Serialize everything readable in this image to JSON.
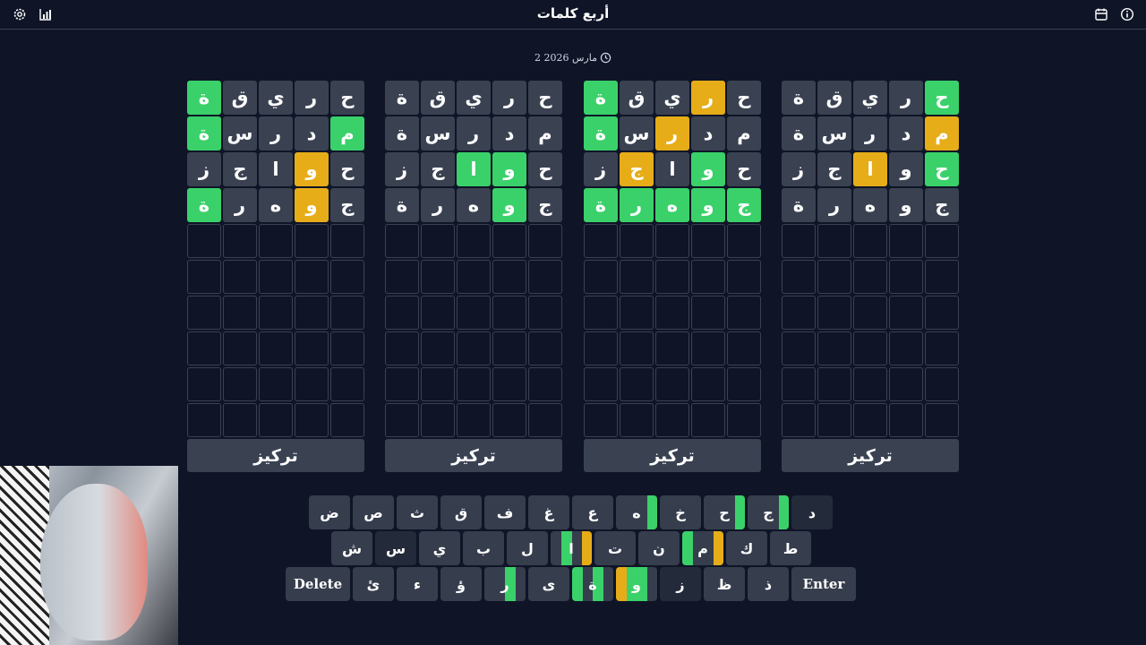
{
  "header": {
    "title": "أربع كلمات"
  },
  "icons": {
    "left": [
      "gear-icon",
      "chart-icon"
    ],
    "right": [
      "calendar-icon",
      "info-icon"
    ]
  },
  "date": "2 مارس 2026",
  "colors": {
    "green": "#3ad16a",
    "yellow": "#e6ad18",
    "tile": "#3a4252",
    "background": "#0f1527"
  },
  "boards": [
    {
      "focus_label": "تركيز",
      "rows": [
        [
          [
            "ح",
            ""
          ],
          [
            "ر",
            ""
          ],
          [
            "ي",
            ""
          ],
          [
            "ق",
            ""
          ],
          [
            "ة",
            "g"
          ]
        ],
        [
          [
            "م",
            "g"
          ],
          [
            "د",
            ""
          ],
          [
            "ر",
            ""
          ],
          [
            "س",
            ""
          ],
          [
            "ة",
            "g"
          ]
        ],
        [
          [
            "ح",
            ""
          ],
          [
            "و",
            "y"
          ],
          [
            "ا",
            ""
          ],
          [
            "ج",
            ""
          ],
          [
            "ز",
            ""
          ]
        ],
        [
          [
            "ج",
            ""
          ],
          [
            "و",
            "y"
          ],
          [
            "ه",
            ""
          ],
          [
            "ر",
            ""
          ],
          [
            "ة",
            "g"
          ]
        ]
      ]
    },
    {
      "focus_label": "تركيز",
      "rows": [
        [
          [
            "ح",
            ""
          ],
          [
            "ر",
            ""
          ],
          [
            "ي",
            ""
          ],
          [
            "ق",
            ""
          ],
          [
            "ة",
            ""
          ]
        ],
        [
          [
            "م",
            ""
          ],
          [
            "د",
            ""
          ],
          [
            "ر",
            ""
          ],
          [
            "س",
            ""
          ],
          [
            "ة",
            ""
          ]
        ],
        [
          [
            "ح",
            ""
          ],
          [
            "و",
            "g"
          ],
          [
            "ا",
            "g"
          ],
          [
            "ج",
            ""
          ],
          [
            "ز",
            ""
          ]
        ],
        [
          [
            "ج",
            ""
          ],
          [
            "و",
            "g"
          ],
          [
            "ه",
            ""
          ],
          [
            "ر",
            ""
          ],
          [
            "ة",
            ""
          ]
        ]
      ]
    },
    {
      "focus_label": "تركيز",
      "rows": [
        [
          [
            "ح",
            ""
          ],
          [
            "ر",
            "y"
          ],
          [
            "ي",
            ""
          ],
          [
            "ق",
            ""
          ],
          [
            "ة",
            "g"
          ]
        ],
        [
          [
            "م",
            ""
          ],
          [
            "د",
            ""
          ],
          [
            "ر",
            "y"
          ],
          [
            "س",
            ""
          ],
          [
            "ة",
            "g"
          ]
        ],
        [
          [
            "ح",
            ""
          ],
          [
            "و",
            "g"
          ],
          [
            "ا",
            ""
          ],
          [
            "ج",
            "y"
          ],
          [
            "ز",
            ""
          ]
        ],
        [
          [
            "ج",
            "g"
          ],
          [
            "و",
            "g"
          ],
          [
            "ه",
            "g"
          ],
          [
            "ر",
            "g"
          ],
          [
            "ة",
            "g"
          ]
        ]
      ]
    },
    {
      "focus_label": "تركيز",
      "rows": [
        [
          [
            "ح",
            "g"
          ],
          [
            "ر",
            ""
          ],
          [
            "ي",
            ""
          ],
          [
            "ق",
            ""
          ],
          [
            "ة",
            ""
          ]
        ],
        [
          [
            "م",
            "y"
          ],
          [
            "د",
            ""
          ],
          [
            "ر",
            ""
          ],
          [
            "س",
            ""
          ],
          [
            "ة",
            ""
          ]
        ],
        [
          [
            "ح",
            "g"
          ],
          [
            "و",
            ""
          ],
          [
            "ا",
            "y"
          ],
          [
            "ج",
            ""
          ],
          [
            "ز",
            ""
          ]
        ],
        [
          [
            "ج",
            ""
          ],
          [
            "و",
            ""
          ],
          [
            "ه",
            ""
          ],
          [
            "ر",
            ""
          ],
          [
            "ة",
            ""
          ]
        ]
      ]
    }
  ],
  "keyboard": [
    [
      {
        "k": "ض"
      },
      {
        "k": "ص"
      },
      {
        "k": "ث"
      },
      {
        "k": "ق"
      },
      {
        "k": "ف"
      },
      {
        "k": "غ"
      },
      {
        "k": "ع"
      },
      {
        "k": "ه",
        "q": [
          "",
          "",
          "",
          "g"
        ]
      },
      {
        "k": "خ"
      },
      {
        "k": "ح",
        "q": [
          "",
          "",
          "",
          "g"
        ]
      },
      {
        "k": "ج",
        "q": [
          "",
          "",
          "",
          "g"
        ]
      },
      {
        "k": "د",
        "dark": true
      }
    ],
    [
      {
        "k": "ش"
      },
      {
        "k": "س",
        "dark": true
      },
      {
        "k": "ي"
      },
      {
        "k": "ب"
      },
      {
        "k": "ل"
      },
      {
        "k": "ا",
        "q": [
          "",
          "g",
          "",
          "y"
        ]
      },
      {
        "k": "ت"
      },
      {
        "k": "ن"
      },
      {
        "k": "م",
        "q": [
          "g",
          "",
          "",
          "y"
        ]
      },
      {
        "k": "ك"
      },
      {
        "k": "ط"
      }
    ],
    [
      {
        "k": "Delete",
        "wide": true
      },
      {
        "k": "ئ"
      },
      {
        "k": "ء"
      },
      {
        "k": "ؤ"
      },
      {
        "k": "ر",
        "q": [
          "",
          "",
          "g",
          ""
        ]
      },
      {
        "k": "ى"
      },
      {
        "k": "ة",
        "q": [
          "g",
          "",
          "g",
          ""
        ]
      },
      {
        "k": "و",
        "q": [
          "y",
          "g",
          "g",
          ""
        ]
      },
      {
        "k": "ز",
        "dark": true
      },
      {
        "k": "ظ"
      },
      {
        "k": "ذ"
      },
      {
        "k": "Enter",
        "wide": true
      }
    ]
  ]
}
